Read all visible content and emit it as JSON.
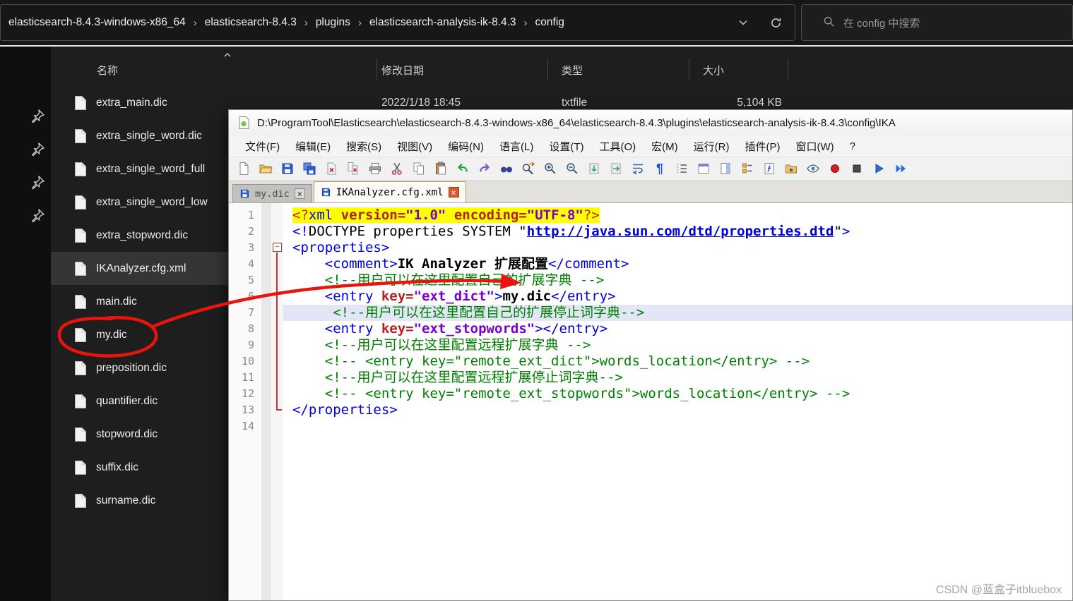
{
  "explorer": {
    "breadcrumb": [
      "elasticsearch-8.4.3-windows-x86_64",
      "elasticsearch-8.4.3",
      "plugins",
      "elasticsearch-analysis-ik-8.4.3",
      "config"
    ],
    "search_placeholder": "在 config 中搜索",
    "columns": [
      "名称",
      "修改日期",
      "类型",
      "大小"
    ],
    "pins": [
      "pin",
      "pin",
      "pin",
      "pin"
    ],
    "files": [
      {
        "name": "extra_main.dic",
        "date": "2022/1/18 18:45",
        "type": "txtfile",
        "size": "5,104 KB",
        "selected": false
      },
      {
        "name": "extra_single_word.dic",
        "date": "",
        "type": "",
        "size": "",
        "selected": false
      },
      {
        "name": "extra_single_word_full",
        "date": "",
        "type": "",
        "size": "",
        "selected": false
      },
      {
        "name": "extra_single_word_low",
        "date": "",
        "type": "",
        "size": "",
        "selected": false
      },
      {
        "name": "extra_stopword.dic",
        "date": "",
        "type": "",
        "size": "",
        "selected": false
      },
      {
        "name": "IKAnalyzer.cfg.xml",
        "date": "",
        "type": "",
        "size": "",
        "selected": true
      },
      {
        "name": "main.dic",
        "date": "",
        "type": "",
        "size": "",
        "selected": false
      },
      {
        "name": "my.dic",
        "date": "",
        "type": "",
        "size": "",
        "selected": false
      },
      {
        "name": "preposition.dic",
        "date": "",
        "type": "",
        "size": "",
        "selected": false
      },
      {
        "name": "quantifier.dic",
        "date": "",
        "type": "",
        "size": "",
        "selected": false
      },
      {
        "name": "stopword.dic",
        "date": "",
        "type": "",
        "size": "",
        "selected": false
      },
      {
        "name": "suffix.dic",
        "date": "",
        "type": "",
        "size": "",
        "selected": false
      },
      {
        "name": "surname.dic",
        "date": "",
        "type": "",
        "size": "",
        "selected": false
      }
    ]
  },
  "notepad": {
    "title": "D:\\ProgramTool\\Elasticsearch\\elasticsearch-8.4.3-windows-x86_64\\elasticsearch-8.4.3\\plugins\\elasticsearch-analysis-ik-8.4.3\\config\\IKA",
    "menus": [
      "文件(F)",
      "编辑(E)",
      "搜索(S)",
      "视图(V)",
      "编码(N)",
      "语言(L)",
      "设置(T)",
      "工具(O)",
      "宏(M)",
      "运行(R)",
      "插件(P)",
      "窗口(W)",
      "?"
    ],
    "toolbar_icons": [
      "new-file",
      "open-folder",
      "save",
      "save-all",
      "close",
      "close-all",
      "print",
      "cut",
      "copy",
      "paste",
      "undo",
      "redo",
      "find",
      "replace",
      "zoom-in",
      "zoom-out",
      "sync-scroll-v",
      "sync-scroll-h",
      "word-wrap",
      "show-all-chars",
      "indent-guide",
      "user-dialog",
      "doc-map",
      "doc-list",
      "function-list",
      "folder-workspace",
      "monitoring",
      "record-macro",
      "stop-macro",
      "playback-macro",
      "run-macro-multiple"
    ],
    "tabs": [
      {
        "label": "my.dic",
        "active": false
      },
      {
        "label": "IKAnalyzer.cfg.xml",
        "active": true
      }
    ]
  },
  "editor": {
    "lines": [
      {
        "num": 1,
        "fold": "",
        "bg": "yellow",
        "segs": [
          {
            "t": "<?",
            "c": "pi"
          },
          {
            "t": "xml",
            "c": "tag"
          },
          {
            "t": " version=",
            "c": "attr"
          },
          {
            "t": "\"1.0\"",
            "c": "val"
          },
          {
            "t": " encoding=",
            "c": "attr"
          },
          {
            "t": "\"UTF-8\"",
            "c": "val"
          },
          {
            "t": "?>",
            "c": "pi"
          }
        ]
      },
      {
        "num": 2,
        "fold": "",
        "segs": [
          {
            "t": "<!",
            "c": "tag"
          },
          {
            "t": "DOCTYPE properties SYSTEM \"",
            "c": "plain"
          },
          {
            "t": "http://java.sun.com/dtd/properties.dtd",
            "c": "link"
          },
          {
            "t": "\"",
            "c": "plain"
          },
          {
            "t": ">",
            "c": "tag"
          }
        ]
      },
      {
        "num": 3,
        "fold": "start",
        "segs": [
          {
            "t": "<properties>",
            "c": "tag"
          }
        ]
      },
      {
        "num": 4,
        "fold": "line",
        "segs": [
          {
            "t": "    ",
            "c": "plain"
          },
          {
            "t": "<comment>",
            "c": "tag"
          },
          {
            "t": "IK Analyzer 扩展配置",
            "c": "txt"
          },
          {
            "t": "</comment>",
            "c": "tag"
          }
        ]
      },
      {
        "num": 5,
        "fold": "line",
        "segs": [
          {
            "t": "    ",
            "c": "plain"
          },
          {
            "t": "<!--用户可以在这里配置自己的扩展字典 -->",
            "c": "com"
          }
        ]
      },
      {
        "num": 6,
        "fold": "line",
        "segs": [
          {
            "t": "    ",
            "c": "plain"
          },
          {
            "t": "<entry",
            "c": "tag"
          },
          {
            "t": " key=",
            "c": "attr"
          },
          {
            "t": "\"ext_dict\"",
            "c": "val"
          },
          {
            "t": ">",
            "c": "tag"
          },
          {
            "t": "my.dic",
            "c": "txt"
          },
          {
            "t": "</entry>",
            "c": "tag"
          }
        ]
      },
      {
        "num": 7,
        "fold": "line",
        "hl": true,
        "segs": [
          {
            "t": "     ",
            "c": "plain"
          },
          {
            "t": "<!--用户可以在这里配置自己的扩展停止词字典-->",
            "c": "com"
          }
        ]
      },
      {
        "num": 8,
        "fold": "line",
        "segs": [
          {
            "t": "    ",
            "c": "plain"
          },
          {
            "t": "<entry",
            "c": "tag"
          },
          {
            "t": " key=",
            "c": "attr"
          },
          {
            "t": "\"ext_stopwords\"",
            "c": "val"
          },
          {
            "t": ">",
            "c": "tag"
          },
          {
            "t": "</entry>",
            "c": "tag"
          }
        ]
      },
      {
        "num": 9,
        "fold": "line",
        "segs": [
          {
            "t": "    ",
            "c": "plain"
          },
          {
            "t": "<!--用户可以在这里配置远程扩展字典 -->",
            "c": "com"
          }
        ]
      },
      {
        "num": 10,
        "fold": "line",
        "segs": [
          {
            "t": "    ",
            "c": "plain"
          },
          {
            "t": "<!-- <entry key=\"remote_ext_dict\">words_location</entry> -->",
            "c": "com"
          }
        ]
      },
      {
        "num": 11,
        "fold": "line",
        "segs": [
          {
            "t": "    ",
            "c": "plain"
          },
          {
            "t": "<!--用户可以在这里配置远程扩展停止词字典-->",
            "c": "com"
          }
        ]
      },
      {
        "num": 12,
        "fold": "line",
        "segs": [
          {
            "t": "    ",
            "c": "plain"
          },
          {
            "t": "<!-- <entry key=\"remote_ext_stopwords\">words_location</entry> -->",
            "c": "com"
          }
        ]
      },
      {
        "num": 13,
        "fold": "end",
        "segs": [
          {
            "t": "</properties>",
            "c": "tag"
          }
        ]
      },
      {
        "num": 14,
        "fold": "",
        "segs": []
      }
    ]
  },
  "icons": {
    "search": "magnifier",
    "refresh": "circular-arrow",
    "breadcrumb_separator": "›",
    "address_dropdown": "chevron-down",
    "sort_ascending": "chevron-up",
    "pin": "pushpin",
    "file": "blank-page",
    "notepad_document": "page-with-green-badge",
    "tab_saved": "blue-floppy",
    "tab_close": "×"
  },
  "watermark": "CSDN @蓝盒子itbluebox"
}
